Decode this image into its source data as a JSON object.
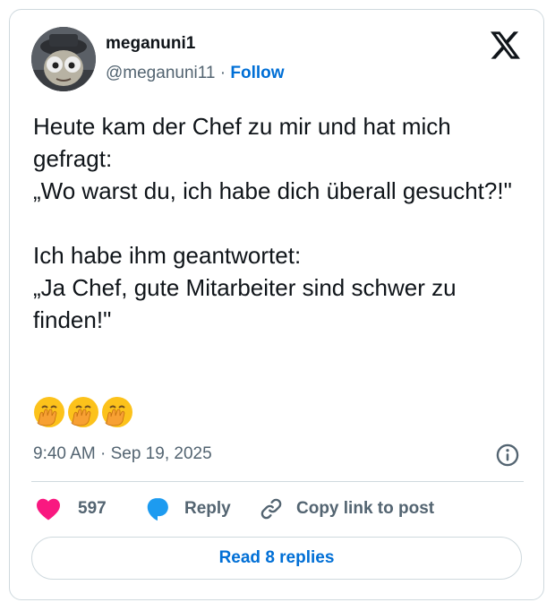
{
  "author": {
    "name": "meganuni1",
    "handle": "@meganuni11",
    "separator": " · ",
    "follow_label": "Follow"
  },
  "tweet": {
    "text": "Heute kam der Chef zu mir und hat mich gefragt:\n„Wo warst du, ich habe dich überall gesucht?!\"\n\nIch habe ihm geantwortet:\n„Ja Chef, gute Mitarbeiter sind schwer zu finden!\"",
    "emojis": [
      "🤭",
      "🤭",
      "🤭"
    ],
    "timestamp": "9:40 AM · Sep 19, 2025"
  },
  "actions": {
    "like_count": "597",
    "reply_label": "Reply",
    "copy_link_label": "Copy link to post"
  },
  "read_replies_label": "Read 8 replies",
  "icons": {
    "logo": "x-logo-icon",
    "info": "info-icon",
    "like": "heart-icon",
    "reply": "speech-bubble-icon",
    "copy": "link-icon"
  },
  "colors": {
    "heart": "#f91880",
    "reply_bubble": "#1d9bf0",
    "link_blue": "#006fd6",
    "muted": "#536471",
    "border": "#cfd9de"
  }
}
